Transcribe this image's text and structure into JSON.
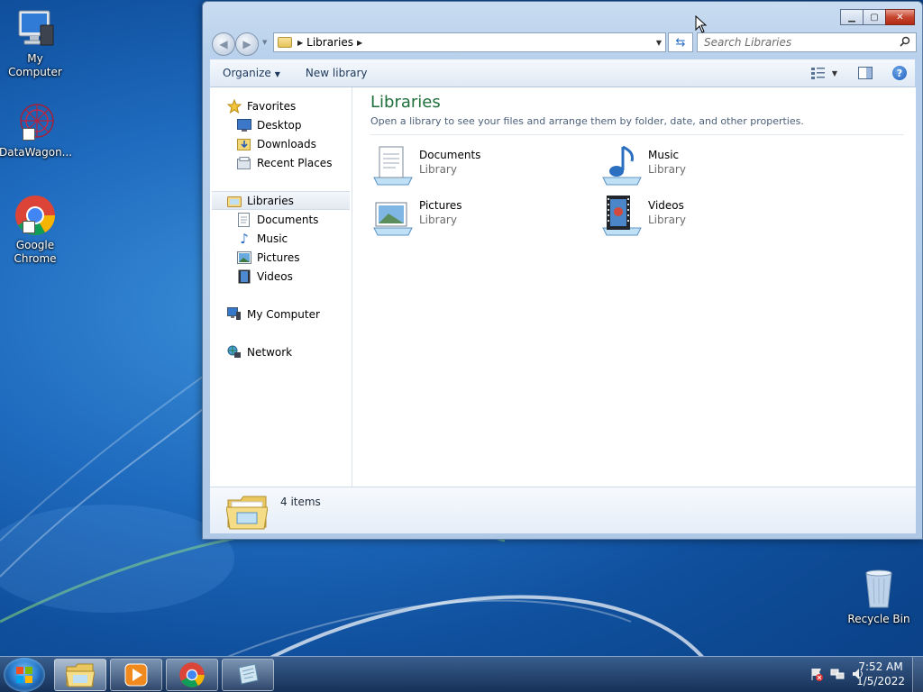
{
  "desktop": {
    "icons": [
      {
        "label": "My Computer",
        "icon": "computer-icon"
      },
      {
        "label": "DataWagon...",
        "icon": "datawagon-icon"
      },
      {
        "label": "Google Chrome",
        "icon": "chrome-icon"
      },
      {
        "label": "Recycle Bin",
        "icon": "recycle-bin-icon"
      }
    ]
  },
  "window": {
    "caption_buttons": {
      "minimize": "minimize-icon",
      "maximize": "maximize-icon",
      "close": "close-icon"
    },
    "address": {
      "crumb": "Libraries"
    },
    "search": {
      "placeholder": "Search Libraries"
    },
    "toolbar": {
      "organize": "Organize",
      "new_library": "New library"
    },
    "nav": {
      "favorites": "Favorites",
      "desktop": "Desktop",
      "downloads": "Downloads",
      "recent_places": "Recent Places",
      "libraries": "Libraries",
      "documents": "Documents",
      "music": "Music",
      "pictures": "Pictures",
      "videos": "Videos",
      "my_computer": "My Computer",
      "network": "Network"
    },
    "content": {
      "title": "Libraries",
      "subtitle": "Open a library to see your files and arrange them by folder, date, and other properties.",
      "items": [
        {
          "name": "Documents",
          "type": "Library",
          "icon": "documents-library-icon"
        },
        {
          "name": "Music",
          "type": "Library",
          "icon": "music-library-icon"
        },
        {
          "name": "Pictures",
          "type": "Library",
          "icon": "pictures-library-icon"
        },
        {
          "name": "Videos",
          "type": "Library",
          "icon": "videos-library-icon"
        }
      ]
    },
    "details": {
      "count": "4 items"
    }
  },
  "taskbar": {
    "clock_time": "7:52 AM",
    "clock_date": "1/5/2022",
    "pinned": [
      "explorer-icon",
      "media-player-icon",
      "chrome-icon",
      "notepad-icon"
    ]
  },
  "colors": {
    "title_green": "#1e6f3a",
    "link_blue": "#1e395b",
    "taskbar": "#1c3f70"
  }
}
